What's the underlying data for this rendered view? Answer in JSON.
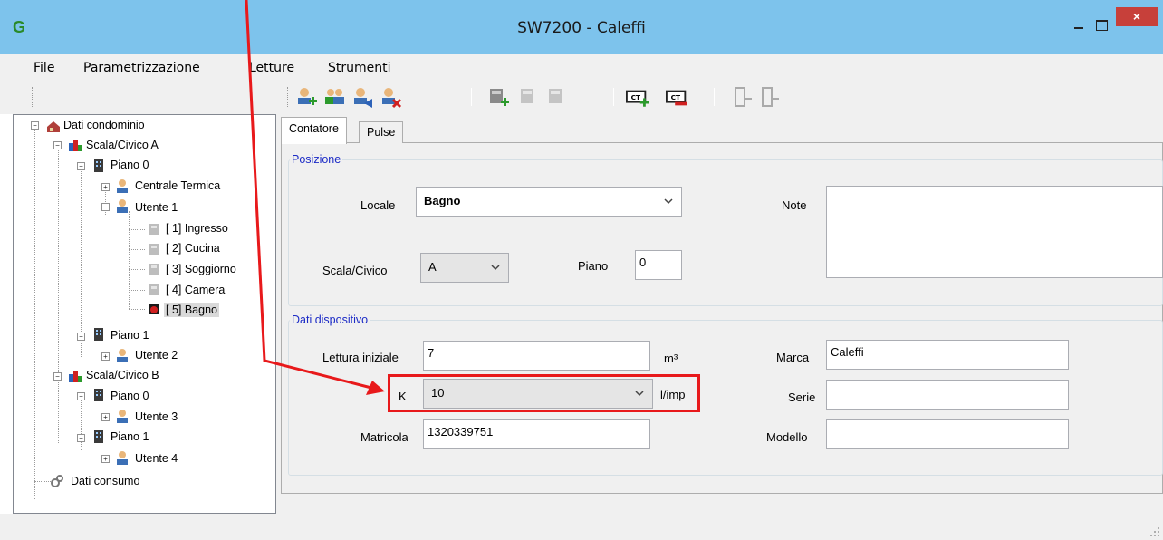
{
  "window": {
    "title": "SW7200 - Caleffi",
    "close_label": "×"
  },
  "menu": {
    "items": [
      "File",
      "Parametrizzazione",
      "Letture",
      "Strumenti"
    ]
  },
  "toolbar": {
    "icons": [
      "add-user-icon",
      "users-icon",
      "user-edit-icon",
      "user-delete-icon",
      "meter-add-icon",
      "meter-edit-icon",
      "meter-remove-icon",
      "ct-add-icon",
      "ct-remove-icon",
      "door-in-icon",
      "door-out-icon"
    ]
  },
  "tree": {
    "root": "Dati condominio",
    "scala_a": "Scala/Civico A",
    "piano_a0": "Piano  0",
    "centrale": "Centrale Termica",
    "utente1": "Utente 1",
    "ingresso": "[ 1] Ingresso",
    "cucina": "[ 2] Cucina",
    "soggiorno": "[ 3] Soggiorno",
    "camera": "[ 4] Camera",
    "bagno": "[ 5] Bagno",
    "piano_a1": "Piano  1",
    "utente2": "Utente 2",
    "scala_b": "Scala/Civico B",
    "piano_b0": "Piano  0",
    "utente3": "Utente 3",
    "piano_b1": "Piano  1",
    "utente4": "Utente 4",
    "consumo": "Dati consumo"
  },
  "tabs": [
    "Contatore",
    "Pulse"
  ],
  "posizione": {
    "title": "Posizione",
    "locale_label": "Locale",
    "locale_value": "Bagno",
    "scala_label": "Scala/Civico",
    "scala_value": "A",
    "piano_label": "Piano",
    "piano_value": "0",
    "note_label": "Note",
    "note_value": ""
  },
  "dispositivo": {
    "title": "Dati dispositivo",
    "lettura_label": "Lettura iniziale",
    "lettura_value": "7",
    "lettura_unit": "m³",
    "k_label": "K",
    "k_value": "10",
    "k_unit": "l/imp",
    "matricola_label": "Matricola",
    "matricola_value": "1320339751",
    "marca_label": "Marca",
    "marca_value": "Caleffi",
    "serie_label": "Serie",
    "serie_value": "",
    "modello_label": "Modello",
    "modello_value": ""
  },
  "colors": {
    "titlebar": "#7dc3ec",
    "close": "#c7403a",
    "group_title": "#1c2bc6",
    "annotation": "#e8191b"
  }
}
